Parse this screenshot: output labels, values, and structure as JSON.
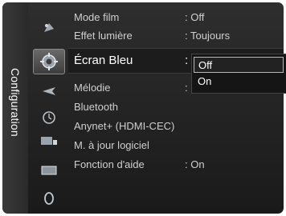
{
  "sidebar": {
    "title": "Configuration"
  },
  "icons": [
    "picture-icon",
    "settings-gear-icon",
    "channel-icon",
    "clock-icon",
    "input-icon",
    "screen-icon",
    "support-icon"
  ],
  "menu": {
    "items": [
      {
        "label": "Mode film",
        "value": ": Off"
      },
      {
        "label": "Effet lumière",
        "value": ": Toujours"
      },
      {
        "label": "Écran Bleu",
        "value": ":"
      },
      {
        "label": "Mélodie",
        "value": ":"
      },
      {
        "label": "Bluetooth",
        "value": ""
      },
      {
        "label": "Anynet+ (HDMI-CEC)",
        "value": ""
      },
      {
        "label": "M. à jour logiciel",
        "value": ""
      },
      {
        "label": "Fonction d'aide",
        "value": ": On"
      }
    ]
  },
  "dropdown": {
    "options": [
      "Off",
      "On"
    ],
    "selected": "Off"
  }
}
